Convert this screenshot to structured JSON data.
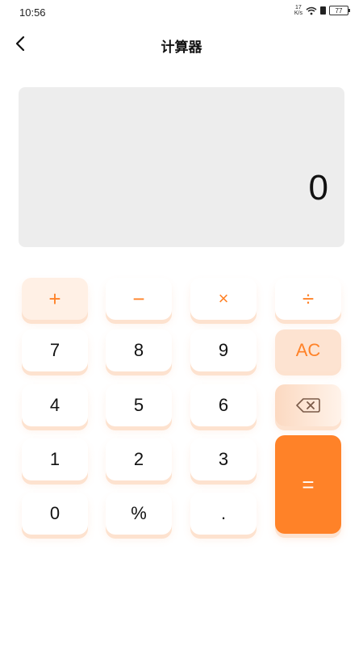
{
  "status_bar": {
    "time": "10:56",
    "net_speed_value": "17",
    "net_speed_unit": "K/s",
    "battery": "77"
  },
  "header": {
    "title": "计算器"
  },
  "display": {
    "value": "0"
  },
  "keys": {
    "plus": "+",
    "minus": "−",
    "multiply": "×",
    "divide": "÷",
    "seven": "7",
    "eight": "8",
    "nine": "9",
    "ac": "AC",
    "four": "4",
    "five": "5",
    "six": "6",
    "one": "1",
    "two": "2",
    "three": "3",
    "zero": "0",
    "percent": "%",
    "dot": ".",
    "equals": "="
  },
  "colors": {
    "accent": "#ff8228",
    "accent_light": "#fde3d1",
    "display_bg": "#ededed"
  }
}
